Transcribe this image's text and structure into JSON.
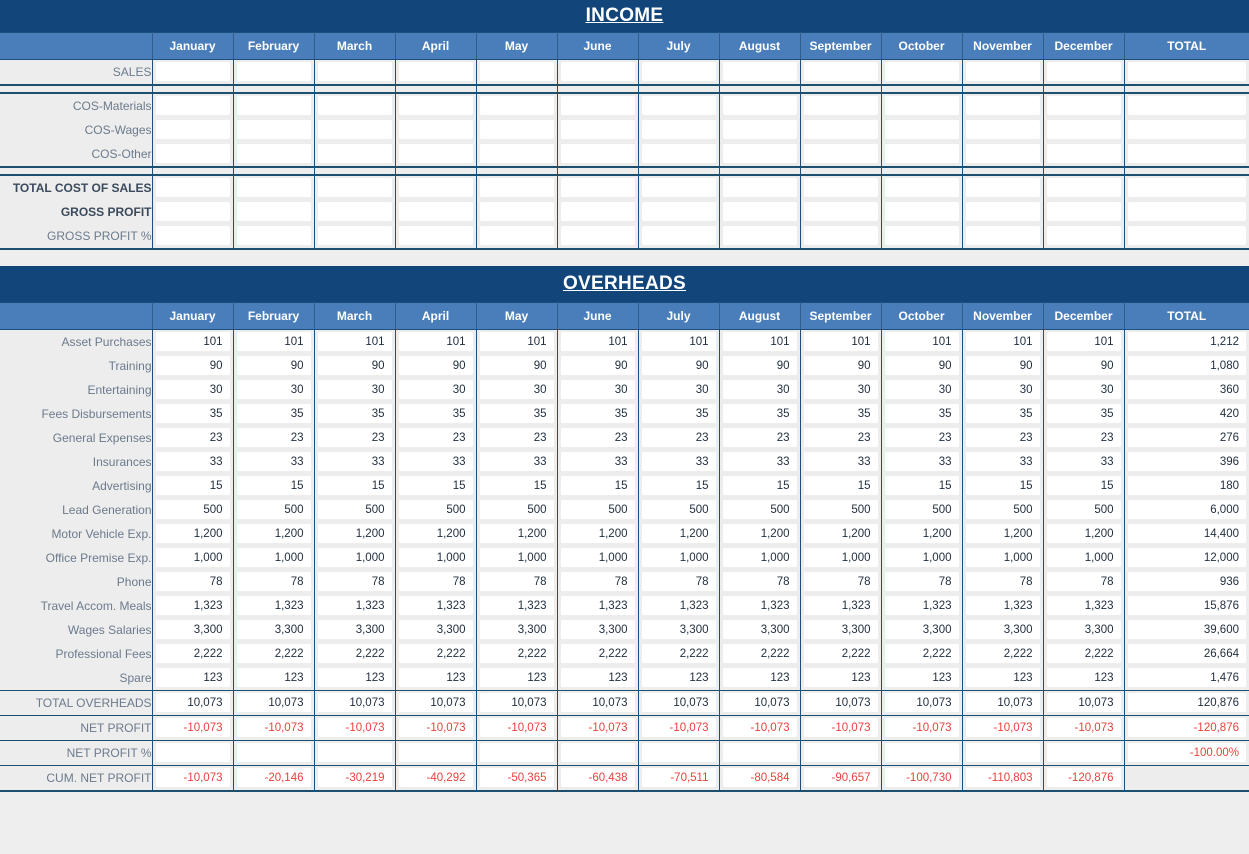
{
  "colors": {
    "title_bar": "#12467b",
    "header_blue": "#4a7ebb",
    "label_grey": "#ededed",
    "negative_red": "#e8413c",
    "grid_line": "#1d5070"
  },
  "months": [
    "January",
    "February",
    "March",
    "April",
    "May",
    "June",
    "July",
    "August",
    "September",
    "October",
    "November",
    "December"
  ],
  "total_header": "TOTAL",
  "income": {
    "title": "INCOME",
    "rows": [
      {
        "label": "SALES",
        "bold": false,
        "values": [
          "",
          "",
          "",
          "",
          "",
          "",
          "",
          "",
          "",
          "",
          "",
          ""
        ],
        "total": ""
      },
      {
        "label": "COS-Materials",
        "bold": false,
        "values": [
          "",
          "",
          "",
          "",
          "",
          "",
          "",
          "",
          "",
          "",
          "",
          ""
        ],
        "total": ""
      },
      {
        "label": "COS-Wages",
        "bold": false,
        "values": [
          "",
          "",
          "",
          "",
          "",
          "",
          "",
          "",
          "",
          "",
          "",
          ""
        ],
        "total": ""
      },
      {
        "label": "COS-Other",
        "bold": false,
        "values": [
          "",
          "",
          "",
          "",
          "",
          "",
          "",
          "",
          "",
          "",
          "",
          ""
        ],
        "total": ""
      },
      {
        "label": "TOTAL COST OF SALES",
        "bold": true,
        "values": [
          "",
          "",
          "",
          "",
          "",
          "",
          "",
          "",
          "",
          "",
          "",
          ""
        ],
        "total": ""
      },
      {
        "label": "GROSS PROFIT",
        "bold": true,
        "values": [
          "",
          "",
          "",
          "",
          "",
          "",
          "",
          "",
          "",
          "",
          "",
          ""
        ],
        "total": ""
      },
      {
        "label": "GROSS PROFIT %",
        "bold": false,
        "values": [
          "",
          "",
          "",
          "",
          "",
          "",
          "",
          "",
          "",
          "",
          "",
          ""
        ],
        "total": ""
      }
    ]
  },
  "overheads": {
    "title": "OVERHEADS",
    "rows": [
      {
        "label": "Asset Purchases",
        "values": [
          "101",
          "101",
          "101",
          "101",
          "101",
          "101",
          "101",
          "101",
          "101",
          "101",
          "101",
          "101"
        ],
        "total": "1,212"
      },
      {
        "label": "Training",
        "values": [
          "90",
          "90",
          "90",
          "90",
          "90",
          "90",
          "90",
          "90",
          "90",
          "90",
          "90",
          "90"
        ],
        "total": "1,080"
      },
      {
        "label": "Entertaining",
        "values": [
          "30",
          "30",
          "30",
          "30",
          "30",
          "30",
          "30",
          "30",
          "30",
          "30",
          "30",
          "30"
        ],
        "total": "360"
      },
      {
        "label": "Fees Disbursements",
        "values": [
          "35",
          "35",
          "35",
          "35",
          "35",
          "35",
          "35",
          "35",
          "35",
          "35",
          "35",
          "35"
        ],
        "total": "420"
      },
      {
        "label": "General Expenses",
        "values": [
          "23",
          "23",
          "23",
          "23",
          "23",
          "23",
          "23",
          "23",
          "23",
          "23",
          "23",
          "23"
        ],
        "total": "276"
      },
      {
        "label": "Insurances",
        "values": [
          "33",
          "33",
          "33",
          "33",
          "33",
          "33",
          "33",
          "33",
          "33",
          "33",
          "33",
          "33"
        ],
        "total": "396"
      },
      {
        "label": "Advertising",
        "values": [
          "15",
          "15",
          "15",
          "15",
          "15",
          "15",
          "15",
          "15",
          "15",
          "15",
          "15",
          "15"
        ],
        "total": "180"
      },
      {
        "label": "Lead Generation",
        "values": [
          "500",
          "500",
          "500",
          "500",
          "500",
          "500",
          "500",
          "500",
          "500",
          "500",
          "500",
          "500"
        ],
        "total": "6,000"
      },
      {
        "label": "Motor Vehicle Exp.",
        "values": [
          "1,200",
          "1,200",
          "1,200",
          "1,200",
          "1,200",
          "1,200",
          "1,200",
          "1,200",
          "1,200",
          "1,200",
          "1,200",
          "1,200"
        ],
        "total": "14,400"
      },
      {
        "label": "Office Premise Exp.",
        "values": [
          "1,000",
          "1,000",
          "1,000",
          "1,000",
          "1,000",
          "1,000",
          "1,000",
          "1,000",
          "1,000",
          "1,000",
          "1,000",
          "1,000"
        ],
        "total": "12,000"
      },
      {
        "label": "Phone",
        "values": [
          "78",
          "78",
          "78",
          "78",
          "78",
          "78",
          "78",
          "78",
          "78",
          "78",
          "78",
          "78"
        ],
        "total": "936"
      },
      {
        "label": "Travel Accom. Meals",
        "values": [
          "1,323",
          "1,323",
          "1,323",
          "1,323",
          "1,323",
          "1,323",
          "1,323",
          "1,323",
          "1,323",
          "1,323",
          "1,323",
          "1,323"
        ],
        "total": "15,876"
      },
      {
        "label": "Wages Salaries",
        "values": [
          "3,300",
          "3,300",
          "3,300",
          "3,300",
          "3,300",
          "3,300",
          "3,300",
          "3,300",
          "3,300",
          "3,300",
          "3,300",
          "3,300"
        ],
        "total": "39,600"
      },
      {
        "label": "Professional Fees",
        "values": [
          "2,222",
          "2,222",
          "2,222",
          "2,222",
          "2,222",
          "2,222",
          "2,222",
          "2,222",
          "2,222",
          "2,222",
          "2,222",
          "2,222"
        ],
        "total": "26,664"
      },
      {
        "label": "Spare",
        "values": [
          "123",
          "123",
          "123",
          "123",
          "123",
          "123",
          "123",
          "123",
          "123",
          "123",
          "123",
          "123"
        ],
        "total": "1,476"
      },
      {
        "label": "TOTAL OVERHEADS",
        "values": [
          "10,073",
          "10,073",
          "10,073",
          "10,073",
          "10,073",
          "10,073",
          "10,073",
          "10,073",
          "10,073",
          "10,073",
          "10,073",
          "10,073"
        ],
        "total": "120,876"
      },
      {
        "label": "NET PROFIT",
        "negative": true,
        "values": [
          "-10,073",
          "-10,073",
          "-10,073",
          "-10,073",
          "-10,073",
          "-10,073",
          "-10,073",
          "-10,073",
          "-10,073",
          "-10,073",
          "-10,073",
          "-10,073"
        ],
        "total": "-120,876"
      },
      {
        "label": "NET PROFIT %",
        "negative": true,
        "values": [
          "",
          "",
          "",
          "",
          "",
          "",
          "",
          "",
          "",
          "",
          "",
          ""
        ],
        "total": "-100.00%"
      },
      {
        "label": "CUM. NET PROFIT",
        "negative": true,
        "no_total_cell": true,
        "values": [
          "-10,073",
          "-20,146",
          "-30,219",
          "-40,292",
          "-50,365",
          "-60,438",
          "-70,511",
          "-80,584",
          "-90,657",
          "-100,730",
          "-110,803",
          "-120,876"
        ],
        "total": ""
      }
    ]
  }
}
